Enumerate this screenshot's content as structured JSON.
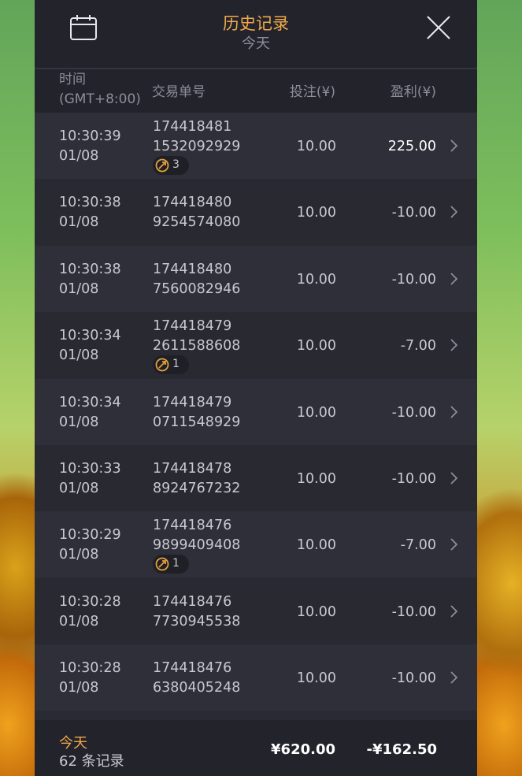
{
  "header": {
    "title": "历史记录",
    "subtitle": "今天",
    "calendar_icon": "calendar-icon",
    "close_icon": "close-icon"
  },
  "columns": {
    "time_line1": "时间",
    "time_line2": "(GMT+8:00)",
    "transaction_id": "交易单号",
    "bet": "投注(¥)",
    "profit": "盈利(¥)"
  },
  "rows": [
    {
      "time": "10:30:39",
      "date": "01/08",
      "id_line1": "174418481",
      "id_line2": "1532092929",
      "badge": "3",
      "bet": "10.00",
      "profit": "225.00",
      "win": true
    },
    {
      "time": "10:30:38",
      "date": "01/08",
      "id_line1": "174418480",
      "id_line2": "9254574080",
      "badge": null,
      "bet": "10.00",
      "profit": "-10.00",
      "win": false
    },
    {
      "time": "10:30:38",
      "date": "01/08",
      "id_line1": "174418480",
      "id_line2": "7560082946",
      "badge": null,
      "bet": "10.00",
      "profit": "-10.00",
      "win": false
    },
    {
      "time": "10:30:34",
      "date": "01/08",
      "id_line1": "174418479",
      "id_line2": "2611588608",
      "badge": "1",
      "bet": "10.00",
      "profit": "-7.00",
      "win": false
    },
    {
      "time": "10:30:34",
      "date": "01/08",
      "id_line1": "174418479",
      "id_line2": "0711548929",
      "badge": null,
      "bet": "10.00",
      "profit": "-10.00",
      "win": false
    },
    {
      "time": "10:30:33",
      "date": "01/08",
      "id_line1": "174418478",
      "id_line2": "8924767232",
      "badge": null,
      "bet": "10.00",
      "profit": "-10.00",
      "win": false
    },
    {
      "time": "10:30:29",
      "date": "01/08",
      "id_line1": "174418476",
      "id_line2": "9899409408",
      "badge": "1",
      "bet": "10.00",
      "profit": "-7.00",
      "win": false
    },
    {
      "time": "10:30:28",
      "date": "01/08",
      "id_line1": "174418476",
      "id_line2": "7730945538",
      "badge": null,
      "bet": "10.00",
      "profit": "-10.00",
      "win": false
    },
    {
      "time": "10:30:28",
      "date": "01/08",
      "id_line1": "174418476",
      "id_line2": "6380405248",
      "badge": null,
      "bet": "10.00",
      "profit": "-10.00",
      "win": false
    }
  ],
  "footer": {
    "label": "今天",
    "count": "62 条记录",
    "total_bet": "¥620.00",
    "total_profit": "-¥162.50"
  },
  "colors": {
    "accent": "#f0a94a",
    "panel_bg": "#2a2a34",
    "header_bg": "#23232c",
    "row_even": "#2f2f39",
    "row_odd": "#292932"
  }
}
